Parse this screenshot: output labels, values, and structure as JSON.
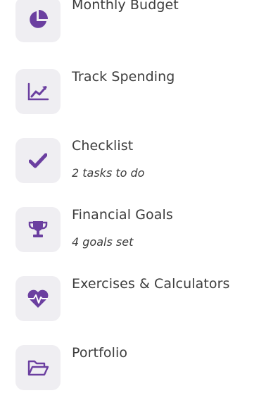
{
  "accent_color": "#6b3fa0",
  "menu": {
    "items": [
      {
        "label": "Monthly Budget",
        "sublabel": null,
        "icon": "pie-chart-icon"
      },
      {
        "label": "Track Spending",
        "sublabel": null,
        "icon": "trend-chart-icon"
      },
      {
        "label": "Checklist",
        "sublabel": "2 tasks to do",
        "icon": "checkmark-icon"
      },
      {
        "label": "Financial Goals",
        "sublabel": "4 goals set",
        "icon": "trophy-icon"
      },
      {
        "label": "Exercises & Calculators",
        "sublabel": null,
        "icon": "heartbeat-icon"
      },
      {
        "label": "Portfolio",
        "sublabel": null,
        "icon": "folder-open-icon"
      }
    ]
  }
}
